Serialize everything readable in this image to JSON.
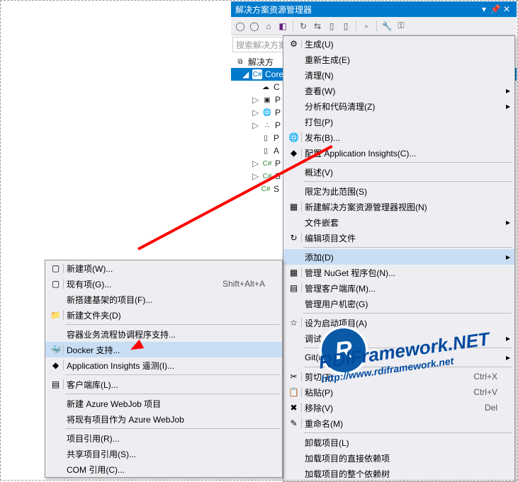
{
  "panel": {
    "title": "解决方案资源管理器",
    "search_placeholder": "搜索解决方案"
  },
  "tree": {
    "sln": "解决方",
    "proj": "Core",
    "nodes": [
      "C",
      "P",
      "P",
      "P",
      "P",
      "A",
      "P",
      "S",
      "S"
    ]
  },
  "menu1": [
    {
      "icon": "build",
      "label": "生成(U)"
    },
    {
      "icon": "",
      "label": "重新生成(E)"
    },
    {
      "icon": "",
      "label": "清理(N)"
    },
    {
      "icon": "",
      "label": "查看(W)",
      "arr": true
    },
    {
      "icon": "",
      "label": "分析和代码清理(Z)",
      "arr": true
    },
    {
      "icon": "",
      "label": "打包(P)"
    },
    {
      "icon": "globe",
      "label": "发布(B)..."
    },
    {
      "icon": "insights",
      "label": "配置 Application Insights(C)..."
    },
    {
      "sep": true
    },
    {
      "icon": "",
      "label": "概述(V)"
    },
    {
      "sep": true
    },
    {
      "icon": "",
      "label": "限定为此范围(S)"
    },
    {
      "icon": "newview",
      "label": "新建解决方案资源管理器视图(N)"
    },
    {
      "icon": "",
      "label": "文件嵌套",
      "arr": true
    },
    {
      "icon": "edit",
      "label": "编辑项目文件"
    },
    {
      "sep": true
    },
    {
      "icon": "",
      "label": "添加(D)",
      "arr": true,
      "hl": true
    },
    {
      "icon": "nuget",
      "label": "管理 NuGet 程序包(N)..."
    },
    {
      "icon": "lib",
      "label": "管理客户端库(M)..."
    },
    {
      "icon": "",
      "label": "管理用户机密(G)"
    },
    {
      "sep": true
    },
    {
      "icon": "star",
      "label": "设为启动项目(A)"
    },
    {
      "icon": "",
      "label": "调试(G)",
      "arr": true
    },
    {
      "sep": true
    },
    {
      "icon": "",
      "label": "Git(I)",
      "arr": true
    },
    {
      "sep": true
    },
    {
      "icon": "cut",
      "label": "剪切(T)",
      "sc": "Ctrl+X"
    },
    {
      "icon": "paste",
      "label": "粘贴(P)",
      "sc": "Ctrl+V"
    },
    {
      "icon": "del",
      "label": "移除(V)",
      "sc": "Del"
    },
    {
      "icon": "rename",
      "label": "重命名(M)"
    },
    {
      "sep": true
    },
    {
      "icon": "",
      "label": "卸载项目(L)"
    },
    {
      "icon": "",
      "label": "加载项目的直接依赖项"
    },
    {
      "icon": "",
      "label": "加载项目的整个依赖树"
    }
  ],
  "menu2": [
    {
      "icon": "newitem",
      "label": "新建项(W)..."
    },
    {
      "icon": "existitem",
      "label": "现有项(G)...",
      "sc": "Shift+Alt+A"
    },
    {
      "icon": "",
      "label": "新搭建基架的项目(F)..."
    },
    {
      "icon": "folder",
      "label": "新建文件夹(D)"
    },
    {
      "sep": true
    },
    {
      "icon": "",
      "label": "容器业务流程协调程序支持..."
    },
    {
      "icon": "docker",
      "label": "Docker 支持...",
      "hl": true
    },
    {
      "icon": "insights",
      "label": "Application Insights 遥测(I)..."
    },
    {
      "sep": true
    },
    {
      "icon": "lib",
      "label": "客户端库(L)..."
    },
    {
      "sep": true
    },
    {
      "icon": "",
      "label": "新建 Azure WebJob 项目"
    },
    {
      "icon": "",
      "label": "将现有项目作为 Azure WebJob"
    },
    {
      "sep": true
    },
    {
      "icon": "",
      "label": "项目引用(R)..."
    },
    {
      "icon": "",
      "label": "共享项目引用(S)..."
    },
    {
      "icon": "",
      "label": "COM 引用(C)..."
    }
  ]
}
